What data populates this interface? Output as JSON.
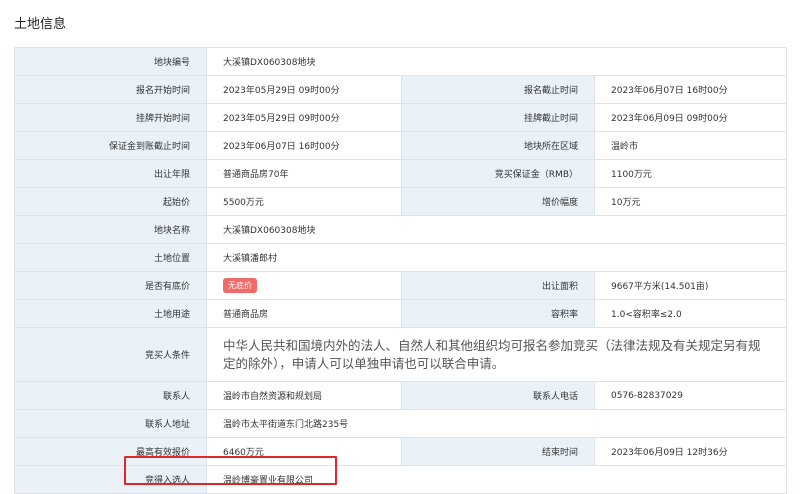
{
  "section": {
    "title": "土地信息"
  },
  "rows": {
    "parcel_no": {
      "label": "地块编号",
      "value": "大溪镇DX060308地块"
    },
    "reg_start": {
      "label": "报名开始时间",
      "value": "2023年05月29日 09时00分"
    },
    "reg_end": {
      "label": "报名截止时间",
      "value": "2023年06月07日 16时00分"
    },
    "listing_start": {
      "label": "挂牌开始时间",
      "value": "2023年05月29日 09时00分"
    },
    "listing_end": {
      "label": "挂牌截止时间",
      "value": "2023年06月09日 09时00分"
    },
    "deposit_deadline": {
      "label": "保证金到账截止时间",
      "value": "2023年06月07日 16时00分"
    },
    "region": {
      "label": "地块所在区域",
      "value": "温岭市"
    },
    "term": {
      "label": "出让年限",
      "value": "普通商品房70年"
    },
    "deposit": {
      "label": "竞买保证金（RMB）",
      "value": "1100万元"
    },
    "start_price": {
      "label": "起始价",
      "value": "5500万元"
    },
    "increment": {
      "label": "增价幅度",
      "value": "10万元"
    },
    "parcel_name": {
      "label": "地块名称",
      "value": "大溪镇DX060308地块"
    },
    "location": {
      "label": "土地位置",
      "value": "大溪镇潘郎村"
    },
    "reserve": {
      "label": "是否有底价",
      "badge": "无底价"
    },
    "area": {
      "label": "出让面积",
      "value": "9667平方米(14.501亩)"
    },
    "usage": {
      "label": "土地用途",
      "value": "普通商品房"
    },
    "far": {
      "label": "容积率",
      "value": "1.0<容积率≤2.0"
    },
    "bidder_cond": {
      "label": "竞买人条件",
      "value": "中华人民共和国境内外的法人、自然人和其他组织均可报名参加竞买（法律法规及有关规定另有规定的除外），申请人可以单独申请也可以联合申请。"
    },
    "contact": {
      "label": "联系人",
      "value": "温岭市自然资源和规划局"
    },
    "phone": {
      "label": "联系人电话",
      "value": "0576-82837029"
    },
    "address": {
      "label": "联系人地址",
      "value": "温岭市太平街道东门北路235号"
    },
    "max_bid": {
      "label": "最高有效报价",
      "value": "6460万元"
    },
    "end_time": {
      "label": "结束时间",
      "value": "2023年06月09日 12时36分"
    },
    "winner": {
      "label": "竞得入选人",
      "value": "温岭博豪置业有限公司"
    }
  },
  "colors": {
    "label_bg": "#eaf2f8",
    "border": "#dfe3e8",
    "badge": "#f06a6a",
    "highlight": "#e02828"
  }
}
